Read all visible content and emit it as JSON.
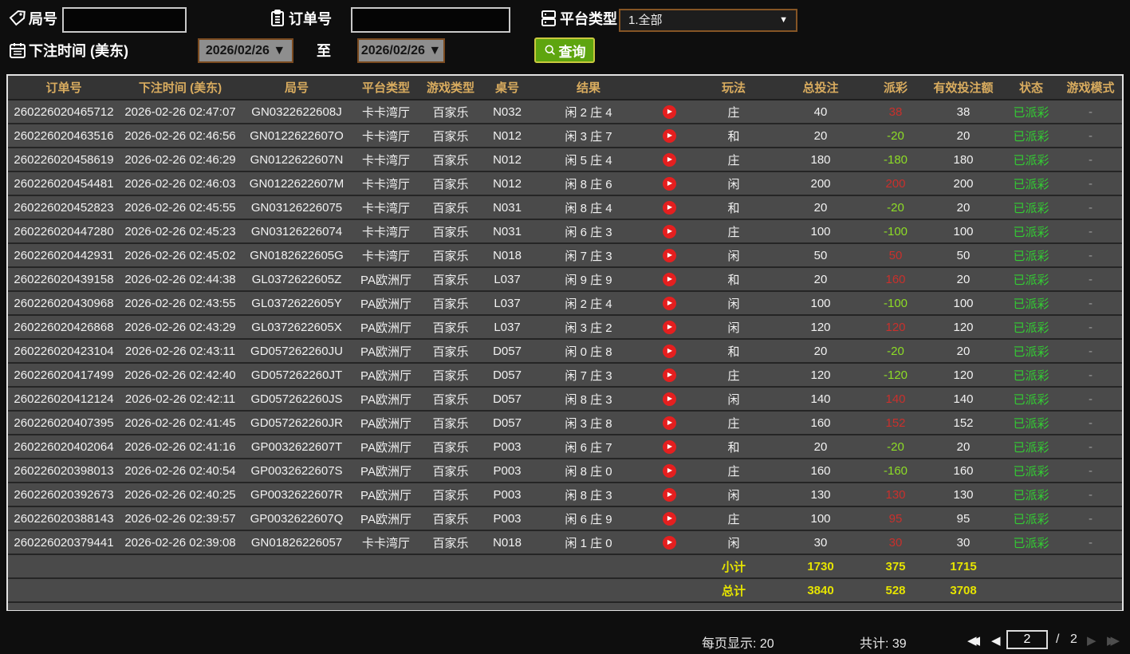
{
  "filters": {
    "game_no_label": "局号",
    "order_no_label": "订单号",
    "platform_label": "平台类型",
    "platform_value": "1.全部",
    "dropdown_arrow": "▼",
    "bet_time_label": "下注时间 (美东)",
    "date_from": "2026/02/26 ▼",
    "to_label": "至",
    "date_to": "2026/02/26 ▼",
    "query_label": "查询"
  },
  "table": {
    "headers": [
      "订单号",
      "下注时间 (美东)",
      "局号",
      "平台类型",
      "游戏类型",
      "桌号",
      "结果",
      "",
      "玩法",
      "总投注",
      "派彩",
      "有效投注额",
      "状态",
      "游戏模式"
    ],
    "rows": [
      {
        "order_no": "260226020465712",
        "bet_time": "2026-02-26 02:47:07",
        "game_no": "GN0322622608J",
        "platform": "卡卡湾厅",
        "game_type": "百家乐",
        "table_no": "N032",
        "result": "闲 2 庄 4",
        "play_type": "庄",
        "total_bet": "40",
        "payout": "38",
        "valid_bet": "38",
        "status": "已派彩",
        "game_mode": "-"
      },
      {
        "order_no": "260226020463516",
        "bet_time": "2026-02-26 02:46:56",
        "game_no": "GN0122622607O",
        "platform": "卡卡湾厅",
        "game_type": "百家乐",
        "table_no": "N012",
        "result": "闲 3 庄 7",
        "play_type": "和",
        "total_bet": "20",
        "payout": "-20",
        "valid_bet": "20",
        "status": "已派彩",
        "game_mode": "-"
      },
      {
        "order_no": "260226020458619",
        "bet_time": "2026-02-26 02:46:29",
        "game_no": "GN0122622607N",
        "platform": "卡卡湾厅",
        "game_type": "百家乐",
        "table_no": "N012",
        "result": "闲 5 庄 4",
        "play_type": "庄",
        "total_bet": "180",
        "payout": "-180",
        "valid_bet": "180",
        "status": "已派彩",
        "game_mode": "-"
      },
      {
        "order_no": "260226020454481",
        "bet_time": "2026-02-26 02:46:03",
        "game_no": "GN0122622607M",
        "platform": "卡卡湾厅",
        "game_type": "百家乐",
        "table_no": "N012",
        "result": "闲 8 庄 6",
        "play_type": "闲",
        "total_bet": "200",
        "payout": "200",
        "valid_bet": "200",
        "status": "已派彩",
        "game_mode": "-"
      },
      {
        "order_no": "260226020452823",
        "bet_time": "2026-02-26 02:45:55",
        "game_no": "GN03126226075",
        "platform": "卡卡湾厅",
        "game_type": "百家乐",
        "table_no": "N031",
        "result": "闲 8 庄 4",
        "play_type": "和",
        "total_bet": "20",
        "payout": "-20",
        "valid_bet": "20",
        "status": "已派彩",
        "game_mode": "-"
      },
      {
        "order_no": "260226020447280",
        "bet_time": "2026-02-26 02:45:23",
        "game_no": "GN03126226074",
        "platform": "卡卡湾厅",
        "game_type": "百家乐",
        "table_no": "N031",
        "result": "闲 6 庄 3",
        "play_type": "庄",
        "total_bet": "100",
        "payout": "-100",
        "valid_bet": "100",
        "status": "已派彩",
        "game_mode": "-"
      },
      {
        "order_no": "260226020442931",
        "bet_time": "2026-02-26 02:45:02",
        "game_no": "GN0182622605G",
        "platform": "卡卡湾厅",
        "game_type": "百家乐",
        "table_no": "N018",
        "result": "闲 7 庄 3",
        "play_type": "闲",
        "total_bet": "50",
        "payout": "50",
        "valid_bet": "50",
        "status": "已派彩",
        "game_mode": "-"
      },
      {
        "order_no": "260226020439158",
        "bet_time": "2026-02-26 02:44:38",
        "game_no": "GL0372622605Z",
        "platform": "PA欧洲厅",
        "game_type": "百家乐",
        "table_no": "L037",
        "result": "闲 9 庄 9",
        "play_type": "和",
        "total_bet": "20",
        "payout": "160",
        "valid_bet": "20",
        "status": "已派彩",
        "game_mode": "-"
      },
      {
        "order_no": "260226020430968",
        "bet_time": "2026-02-26 02:43:55",
        "game_no": "GL0372622605Y",
        "platform": "PA欧洲厅",
        "game_type": "百家乐",
        "table_no": "L037",
        "result": "闲 2 庄 4",
        "play_type": "闲",
        "total_bet": "100",
        "payout": "-100",
        "valid_bet": "100",
        "status": "已派彩",
        "game_mode": "-"
      },
      {
        "order_no": "260226020426868",
        "bet_time": "2026-02-26 02:43:29",
        "game_no": "GL0372622605X",
        "platform": "PA欧洲厅",
        "game_type": "百家乐",
        "table_no": "L037",
        "result": "闲 3 庄 2",
        "play_type": "闲",
        "total_bet": "120",
        "payout": "120",
        "valid_bet": "120",
        "status": "已派彩",
        "game_mode": "-"
      },
      {
        "order_no": "260226020423104",
        "bet_time": "2026-02-26 02:43:11",
        "game_no": "GD057262260JU",
        "platform": "PA欧洲厅",
        "game_type": "百家乐",
        "table_no": "D057",
        "result": "闲 0 庄 8",
        "play_type": "和",
        "total_bet": "20",
        "payout": "-20",
        "valid_bet": "20",
        "status": "已派彩",
        "game_mode": "-"
      },
      {
        "order_no": "260226020417499",
        "bet_time": "2026-02-26 02:42:40",
        "game_no": "GD057262260JT",
        "platform": "PA欧洲厅",
        "game_type": "百家乐",
        "table_no": "D057",
        "result": "闲 7 庄 3",
        "play_type": "庄",
        "total_bet": "120",
        "payout": "-120",
        "valid_bet": "120",
        "status": "已派彩",
        "game_mode": "-"
      },
      {
        "order_no": "260226020412124",
        "bet_time": "2026-02-26 02:42:11",
        "game_no": "GD057262260JS",
        "platform": "PA欧洲厅",
        "game_type": "百家乐",
        "table_no": "D057",
        "result": "闲 8 庄 3",
        "play_type": "闲",
        "total_bet": "140",
        "payout": "140",
        "valid_bet": "140",
        "status": "已派彩",
        "game_mode": "-"
      },
      {
        "order_no": "260226020407395",
        "bet_time": "2026-02-26 02:41:45",
        "game_no": "GD057262260JR",
        "platform": "PA欧洲厅",
        "game_type": "百家乐",
        "table_no": "D057",
        "result": "闲 3 庄 8",
        "play_type": "庄",
        "total_bet": "160",
        "payout": "152",
        "valid_bet": "152",
        "status": "已派彩",
        "game_mode": "-"
      },
      {
        "order_no": "260226020402064",
        "bet_time": "2026-02-26 02:41:16",
        "game_no": "GP0032622607T",
        "platform": "PA欧洲厅",
        "game_type": "百家乐",
        "table_no": "P003",
        "result": "闲 6 庄 7",
        "play_type": "和",
        "total_bet": "20",
        "payout": "-20",
        "valid_bet": "20",
        "status": "已派彩",
        "game_mode": "-"
      },
      {
        "order_no": "260226020398013",
        "bet_time": "2026-02-26 02:40:54",
        "game_no": "GP0032622607S",
        "platform": "PA欧洲厅",
        "game_type": "百家乐",
        "table_no": "P003",
        "result": "闲 8 庄 0",
        "play_type": "庄",
        "total_bet": "160",
        "payout": "-160",
        "valid_bet": "160",
        "status": "已派彩",
        "game_mode": "-"
      },
      {
        "order_no": "260226020392673",
        "bet_time": "2026-02-26 02:40:25",
        "game_no": "GP0032622607R",
        "platform": "PA欧洲厅",
        "game_type": "百家乐",
        "table_no": "P003",
        "result": "闲 8 庄 3",
        "play_type": "闲",
        "total_bet": "130",
        "payout": "130",
        "valid_bet": "130",
        "status": "已派彩",
        "game_mode": "-"
      },
      {
        "order_no": "260226020388143",
        "bet_time": "2026-02-26 02:39:57",
        "game_no": "GP0032622607Q",
        "platform": "PA欧洲厅",
        "game_type": "百家乐",
        "table_no": "P003",
        "result": "闲 6 庄 9",
        "play_type": "庄",
        "total_bet": "100",
        "payout": "95",
        "valid_bet": "95",
        "status": "已派彩",
        "game_mode": "-"
      },
      {
        "order_no": "260226020379441",
        "bet_time": "2026-02-26 02:39:08",
        "game_no": "GN01826226057",
        "platform": "卡卡湾厅",
        "game_type": "百家乐",
        "table_no": "N018",
        "result": "闲 1 庄 0",
        "play_type": "闲",
        "total_bet": "30",
        "payout": "30",
        "valid_bet": "30",
        "status": "已派彩",
        "game_mode": "-"
      }
    ],
    "subtotal": {
      "label": "小计",
      "total_bet": "1730",
      "payout": "375",
      "valid_bet": "1715"
    },
    "total": {
      "label": "总计",
      "total_bet": "3840",
      "payout": "528",
      "valid_bet": "3708"
    }
  },
  "footer": {
    "per_page_label": "每页显示: 20",
    "total_count_label": "共计: 39",
    "first_icon": "◀◀",
    "prev_icon": "◀",
    "page_value": "2",
    "separator": "/",
    "page_total": "2",
    "next_icon": "▶",
    "last_icon": "▶▶"
  },
  "colors": {
    "accent_gold": "#d9ac5f",
    "payout_win_red": "#c9302c",
    "payout_loss_green": "#8ddc26",
    "status_green": "#33cc33",
    "totals_yellow": "#e6e400",
    "query_button_green": "#5ea50f",
    "play_button_red": "#e51f1f"
  }
}
